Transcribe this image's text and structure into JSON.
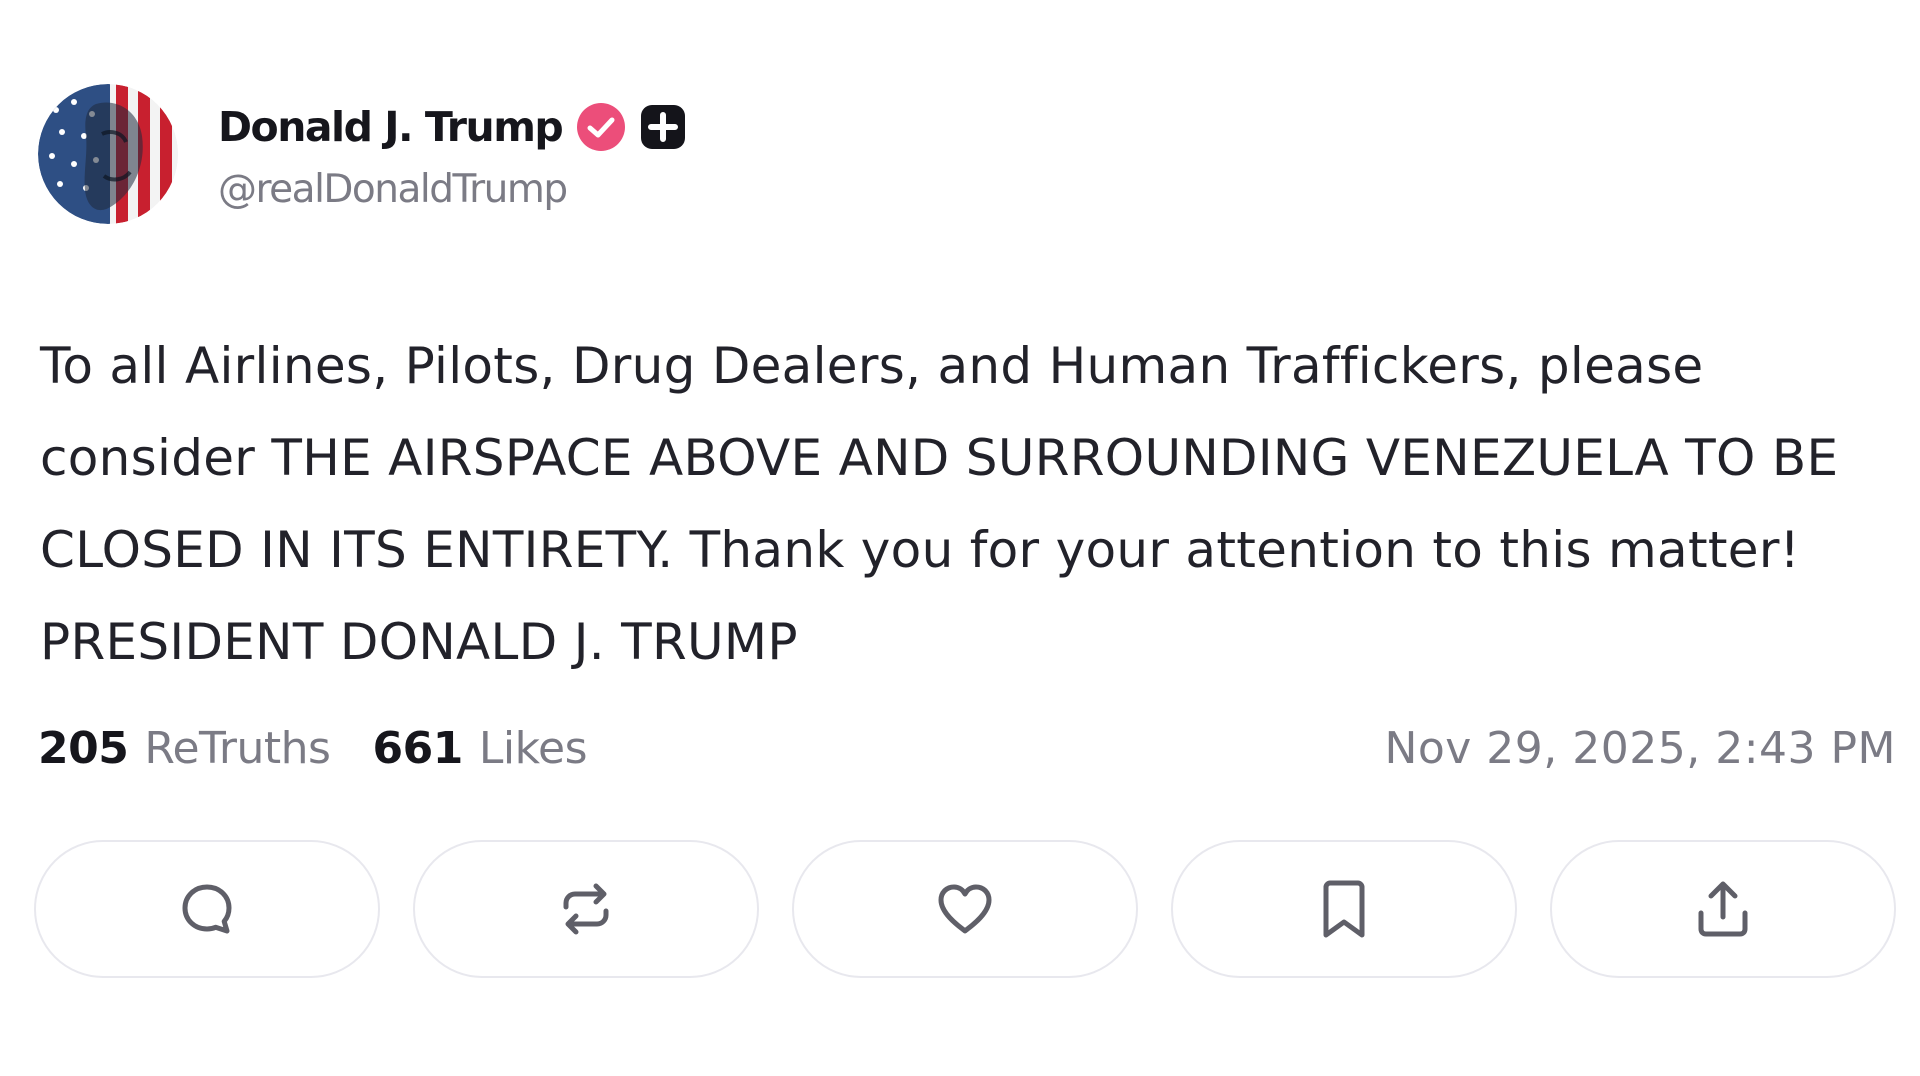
{
  "author": {
    "display_name": "Donald J. Trump",
    "handle": "@realDonaldTrump",
    "avatar_icon": "flag-portrait-avatar",
    "verified_icon": "verified-badge-icon",
    "verified_color": "#ec4e7a",
    "plus_badge_icon": "plus-badge-icon"
  },
  "post": {
    "text": "To all Airlines, Pilots, Drug Dealers, and Human Traffickers, please consider THE AIRSPACE ABOVE AND SURROUNDING VENEZUELA TO BE CLOSED IN ITS ENTIRETY. Thank you for your attention to this matter! PRESIDENT DONALD J. TRUMP"
  },
  "stats": {
    "retruths_count": "205",
    "retruths_label": "ReTruths",
    "likes_count": "661",
    "likes_label": "Likes",
    "timestamp": "Nov 29, 2025, 2:43 PM"
  },
  "actions": [
    {
      "name": "reply",
      "icon": "comment-icon"
    },
    {
      "name": "retruth",
      "icon": "repost-icon"
    },
    {
      "name": "like",
      "icon": "heart-icon"
    },
    {
      "name": "bookmark",
      "icon": "bookmark-icon"
    },
    {
      "name": "share",
      "icon": "share-icon"
    }
  ],
  "colors": {
    "text": "#22222a",
    "muted": "#7b7b85",
    "button_border": "#e8e8ee",
    "icon": "#5f5f68"
  }
}
